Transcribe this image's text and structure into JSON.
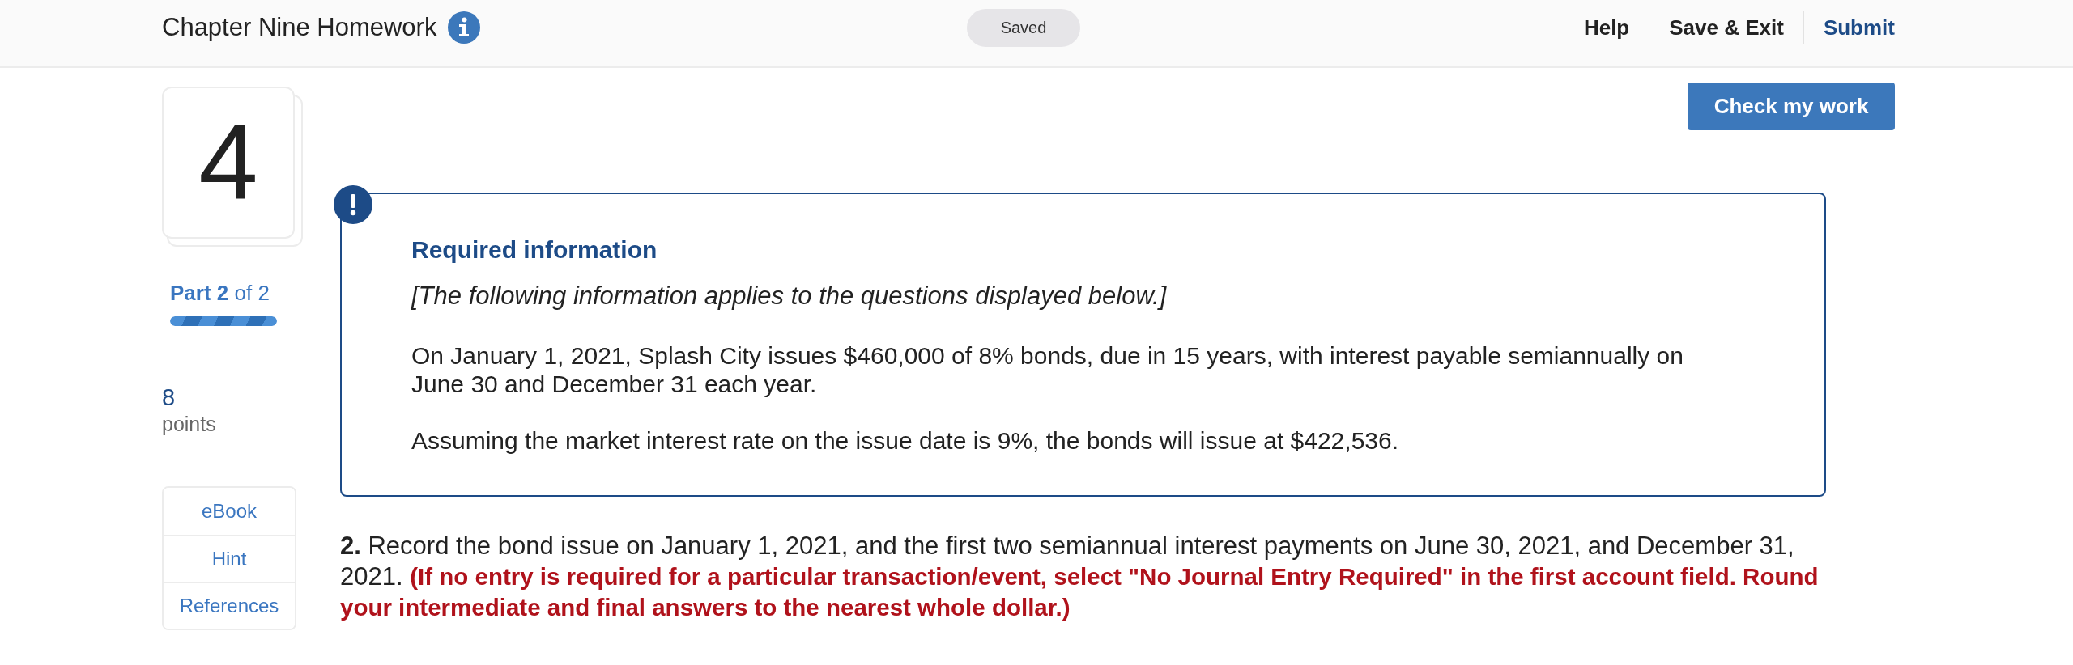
{
  "header": {
    "title": "Chapter Nine Homework",
    "status": "Saved",
    "links": [
      {
        "label": "Help",
        "kind": "plain"
      },
      {
        "label": "Save & Exit",
        "kind": "plain"
      },
      {
        "label": "Submit",
        "kind": "primary"
      }
    ]
  },
  "sidebar": {
    "question_number": "4",
    "part": {
      "label": "**Part 2** of 2",
      "level": 1
    },
    "points": {
      "value": "8",
      "label": "points"
    },
    "resources": [
      "eBook",
      "Hint",
      "References"
    ]
  },
  "check_button": "Check my work",
  "info_box": {
    "title": "Required information",
    "note": "[The following information applies to the questions displayed below.]",
    "paragraphs": [
      "On January 1, 2021, Splash City issues $460,000 of 8% bonds, due in 15 years, with interest payable semiannually on June 30 and December 31 each year.",
      "Assuming the market interest rate on the issue date is 9%, the bonds will issue at $422,536."
    ]
  },
  "question": {
    "number": "2.",
    "text": "Record the bond issue on January 1, 2021, and the first two semiannual interest payments on June 30, 2021, and December 31, 2021.",
    "instruction": "(If no entry is required for a particular transaction/event, select \"No Journal Entry Required\" in the first account field. Round your intermediate and final answers to the nearest whole dollar.)"
  }
}
